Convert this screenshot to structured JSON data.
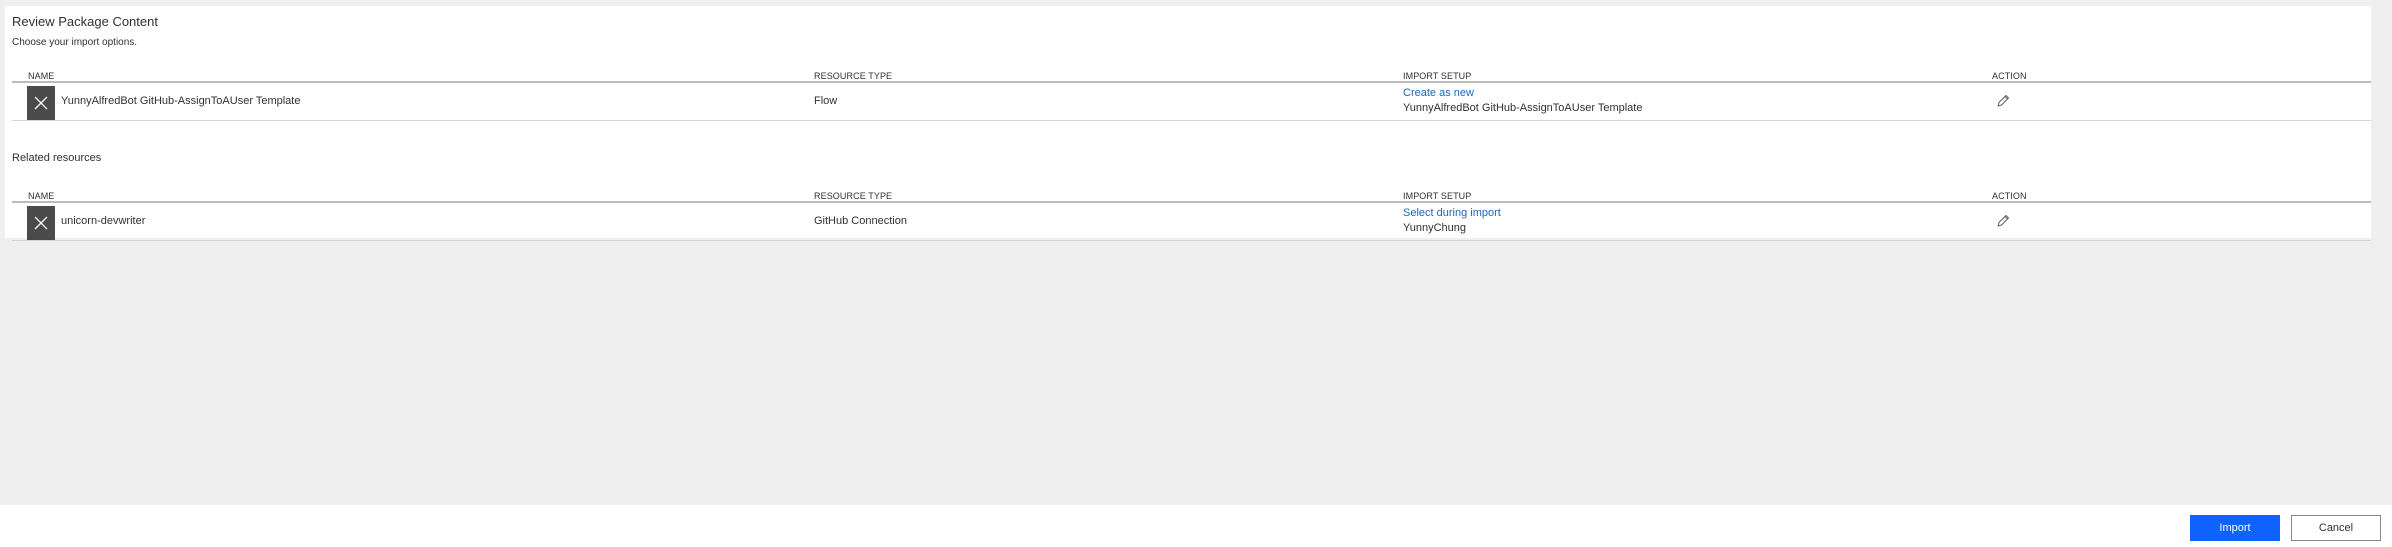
{
  "panel": {
    "title": "Review Package Content",
    "subtitle": "Choose your import options."
  },
  "columns": {
    "name": "NAME",
    "resource_type": "RESOURCE TYPE",
    "import_setup": "IMPORT SETUP",
    "action": "ACTION"
  },
  "package_rows": [
    {
      "name": "YunnyAlfredBot GitHub-AssignToAUser Template",
      "resource_type": "Flow",
      "import_setup_link": "Create as new",
      "import_setup_value": "YunnyAlfredBot GitHub-AssignToAUser Template",
      "icon": "close-x-icon",
      "action_icon": "edit-pencil-icon"
    }
  ],
  "related": {
    "title": "Related resources",
    "rows": [
      {
        "name": "unicorn-devwriter",
        "resource_type": "GitHub Connection",
        "import_setup_link": "Select during import",
        "import_setup_value": "YunnyChung",
        "icon": "close-x-icon",
        "action_icon": "edit-pencil-icon"
      }
    ]
  },
  "footer": {
    "import_label": "Import",
    "cancel_label": "Cancel"
  },
  "colors": {
    "accent": "#0f62fe",
    "link": "#1a66c2",
    "icon_bg": "#4a4a4a",
    "page_bg": "#efefef"
  }
}
